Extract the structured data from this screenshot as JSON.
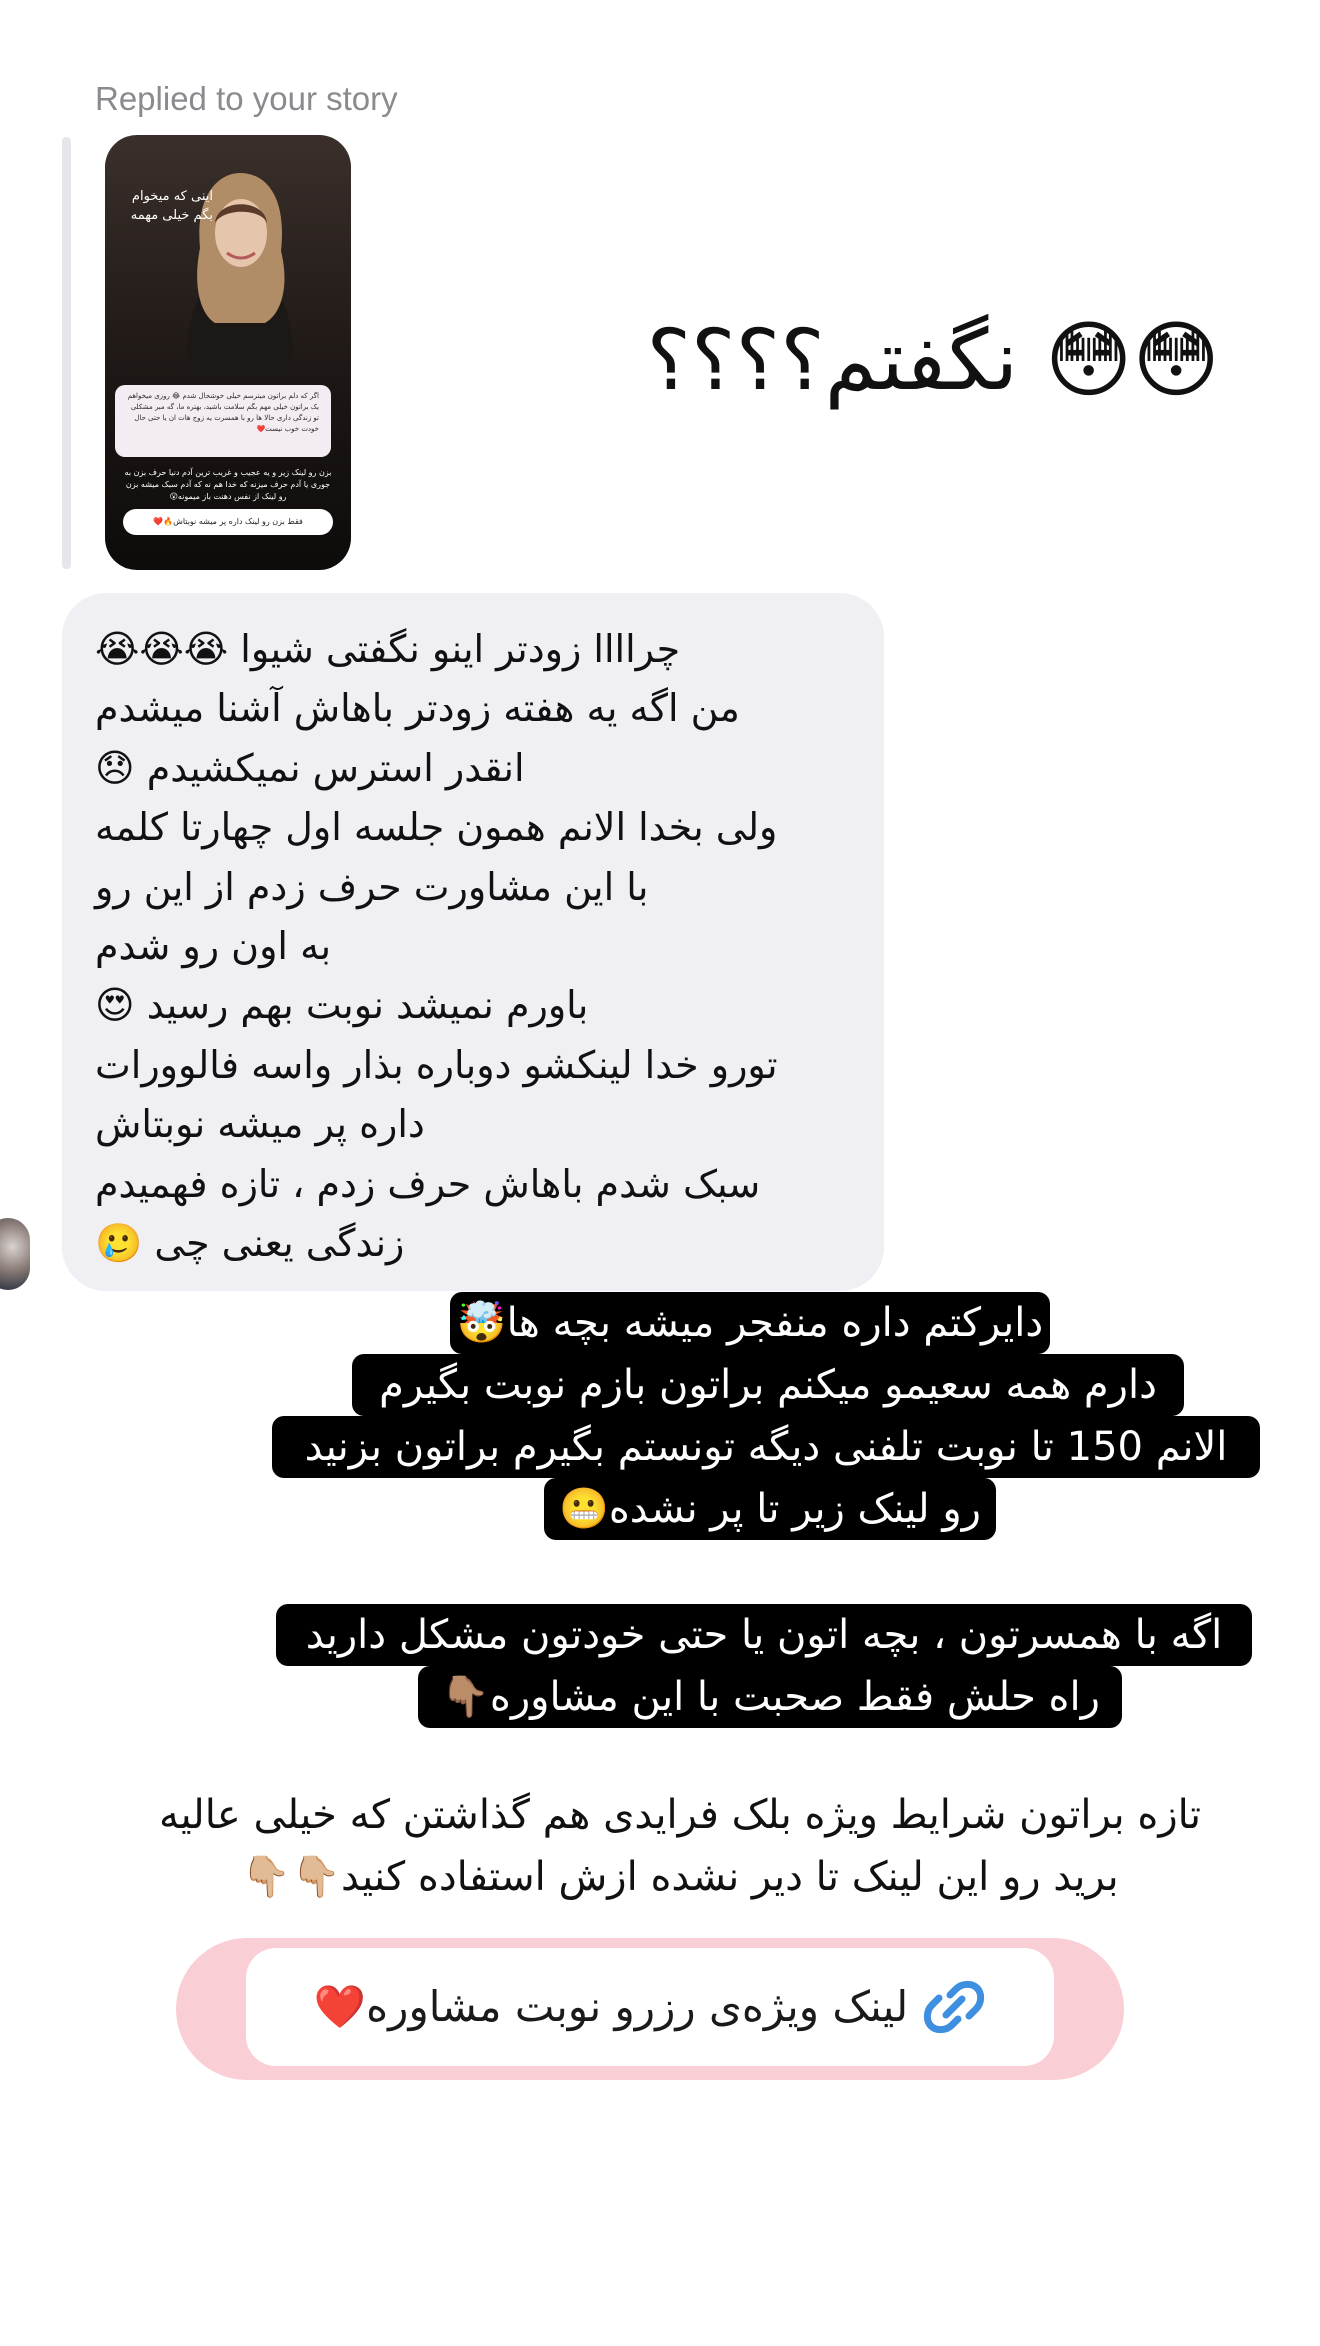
{
  "story_reply": {
    "label": "Replied to your story",
    "story": {
      "heading": "اینی که میخوام بگم خیلی مهمه",
      "card_text": "اگر که دلم براتون میترسم خیلی خوشحال شدم 😂 روزی میخواهم یک براتون خیلی مهم بگم  سلامت باشید، بهتره ما، گه مبر مشکلی تو زندگی داری حالا ها رو با همسرت یه زوج هات ان یا حتی حال خودت خوب نیست❤️",
      "text2": "بزن رو لینک زیر و یه عجیب و غریب ترین آدم دنیا حرف بزن به جوری یا آدم حرف میزنه که خدا هم نه که آدم سبک میشه بزن رو لینک از نفس دهنت باز میمونه😮",
      "pill": "فقط بزن رو لینک داره پر میشه نوبتاش🔥❤️"
    }
  },
  "big_reply": "😳😳 نگفتم؟؟؟؟",
  "message_lines": [
    "چراااا زودتر اینو نگفتی شیوا 😭😭😭",
    "من اگه یه هفته زودتر باهاش آشنا میشدم",
    "انقدر استرس نمیکشیدم 😞",
    "ولی بخدا الانم همون جلسه اول چهارتا کلمه",
    "با این مشاورت حرف زدم از این رو",
    "به اون رو شدم",
    "باورم نمیشد نوبت بهم رسید 😍",
    "تورو خدا لینکشو دوباره بذار واسه فالوورات",
    "داره پر میشه نوبتاش",
    "سبک شدم باهاش حرف زدم ، تازه فهمیدم",
    "زندگی یعنی چی 🥲"
  ],
  "highlight_block_1": [
    "دایرکتم داره منفجر میشه بچه ها🤯",
    "دارم همه سعیمو میکنم براتون بازم نوبت بگیرم",
    "الانم 150 تا نوبت تلفنی دیگه تونستم بگیرم براتون بزنید",
    "رو لینک زیر تا پر نشده😬"
  ],
  "highlight_block_2": [
    "اگه با همسرتون ، بچه اتون یا حتی خودتون مشکل دارید",
    "راه حلش فقط صحبت با این مشاوره👇🏽"
  ],
  "plain_lines": [
    "تازه براتون شرایط ویژه بلک فرایدی هم گذاشتن که خیلی عالیه",
    "برید رو این لینک تا دیر نشده ازش استفاده کنید👇🏼👇🏼"
  ],
  "link_sticker": {
    "text": "لینک ویژه‌ی رزرو نوبت مشاوره❤️",
    "icon": "link-icon",
    "icon_color": "#3e8fe0",
    "outer_color": "#f9ced5"
  }
}
